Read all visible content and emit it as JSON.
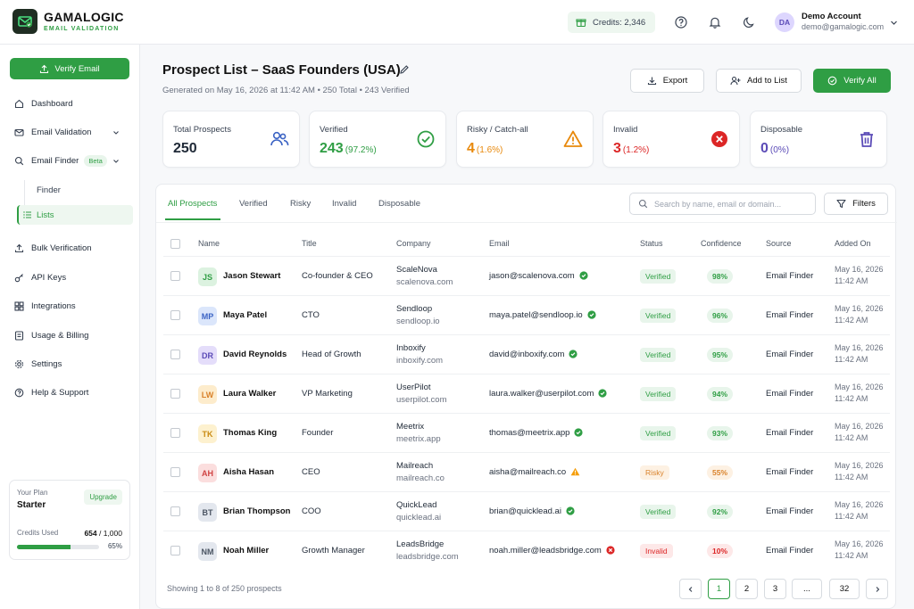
{
  "app": {
    "name": "GAMALOGIC",
    "tagline": "EMAIL VALIDATION"
  },
  "topbar": {
    "credits_label": "Credits: 2,346",
    "account_initials": "DA",
    "account_name": "Demo Account",
    "account_email": "demo@gamalogic.com",
    "icons": [
      "gift-icon",
      "help-icon",
      "bell-icon",
      "moon-icon",
      "chevron-down-icon"
    ]
  },
  "sidebar": {
    "verify_label": "Verify Email",
    "items": [
      {
        "label": "Dashboard",
        "icon": "home-icon"
      },
      {
        "label": "Email Validation",
        "icon": "mail-icon"
      },
      {
        "label": "Email Finder",
        "icon": "search-icon",
        "badge": "Beta"
      },
      {
        "label": "Bulk Verification",
        "icon": "upload-icon"
      },
      {
        "label": "API Keys",
        "icon": "key-icon"
      },
      {
        "label": "Integrations",
        "icon": "puzzle-icon"
      },
      {
        "label": "Usage & Billing",
        "icon": "billing-icon"
      },
      {
        "label": "Settings",
        "icon": "gear-icon"
      },
      {
        "label": "Help & Support",
        "icon": "help-icon"
      }
    ],
    "sub_items": [
      {
        "label": "Finder"
      },
      {
        "label": "Lists"
      }
    ],
    "plan": {
      "label": "Your Plan",
      "name": "Starter",
      "upgrade_label": "Upgrade",
      "credits_label": "Credits Used",
      "credits_used": "654",
      "credits_total": "/ 1,000",
      "percent_label": "65%",
      "percent": 65
    }
  },
  "page": {
    "title": "Prospect List – SaaS Founders (USA)",
    "subtitle": "Generated on May 16, 2026 at 11:42 AM  •  250 Total  •  243 Verified",
    "export_label": "Export",
    "add_label": "Add to List",
    "verify_all_label": "Verify All"
  },
  "stats": [
    {
      "label": "Total Prospects",
      "value": "250",
      "pct": "",
      "color": "#111111",
      "icon": "users-icon"
    },
    {
      "label": "Verified",
      "value": "243",
      "pct": "(97.2%)",
      "color": "#2f9e44",
      "icon": "check-circle-icon"
    },
    {
      "label": "Risky / Catch-all",
      "value": "4",
      "pct": "(1.6%)",
      "color": "#e8890c",
      "icon": "warning-icon"
    },
    {
      "label": "Invalid",
      "value": "3",
      "pct": "(1.2%)",
      "color": "#dc2626",
      "icon": "x-circle-icon"
    },
    {
      "label": "Disposable",
      "value": "0",
      "pct": "(0%)",
      "color": "#5b4bb7",
      "icon": "trash-icon"
    }
  ],
  "tabs": [
    {
      "label": "All Prospects",
      "active": true
    },
    {
      "label": "Verified"
    },
    {
      "label": "Risky"
    },
    {
      "label": "Invalid"
    },
    {
      "label": "Disposable"
    }
  ],
  "search": {
    "placeholder": "Search by name, email or domain..."
  },
  "filters_label": "Filters",
  "table": {
    "columns": [
      "Name",
      "Title",
      "Company",
      "Email",
      "Status",
      "Confidence",
      "Source",
      "Added On"
    ],
    "rows": [
      {
        "initials": "JS",
        "name": "Jason Stewart",
        "title": "Co-founder & CEO",
        "company": "ScaleNova",
        "domain": "scalenova.com",
        "email": "jason@scalenova.com",
        "status": "Verified",
        "confidence": "98%",
        "source": "Email Finder",
        "date": "May 16, 2026",
        "time": "11:42 AM",
        "avatar_bg": "#dcf2e0",
        "avatar_fg": "#2f9e44"
      },
      {
        "initials": "MP",
        "name": "Maya Patel",
        "title": "CTO",
        "company": "Sendloop",
        "domain": "sendloop.io",
        "email": "maya.patel@sendloop.io",
        "status": "Verified",
        "confidence": "96%",
        "source": "Email Finder",
        "date": "May 16, 2026",
        "time": "11:42 AM",
        "avatar_bg": "#dbe6fb",
        "avatar_fg": "#3b63c4"
      },
      {
        "initials": "DR",
        "name": "David Reynolds",
        "title": "Head of Growth",
        "company": "Inboxify",
        "domain": "inboxify.com",
        "email": "david@inboxify.com",
        "status": "Verified",
        "confidence": "95%",
        "source": "Email Finder",
        "date": "May 16, 2026",
        "time": "11:42 AM",
        "avatar_bg": "#e4ddfa",
        "avatar_fg": "#5b4bb7"
      },
      {
        "initials": "LW",
        "name": "Laura Walker",
        "title": "VP Marketing",
        "company": "UserPilot",
        "domain": "userpilot.com",
        "email": "laura.walker@userpilot.com",
        "status": "Verified",
        "confidence": "94%",
        "source": "Email Finder",
        "date": "May 16, 2026",
        "time": "11:42 AM",
        "avatar_bg": "#fdeccc",
        "avatar_fg": "#d9822b"
      },
      {
        "initials": "TK",
        "name": "Thomas King",
        "title": "Founder",
        "company": "Meetrix",
        "domain": "meetrix.app",
        "email": "thomas@meetrix.app",
        "status": "Verified",
        "confidence": "93%",
        "source": "Email Finder",
        "date": "May 16, 2026",
        "time": "11:42 AM",
        "avatar_bg": "#fdf1cf",
        "avatar_fg": "#c98a12"
      },
      {
        "initials": "AH",
        "name": "Aisha Hasan",
        "title": "CEO",
        "company": "Mailreach",
        "domain": "mailreach.co",
        "email": "aisha@mailreach.co",
        "status": "Risky",
        "confidence": "55%",
        "source": "Email Finder",
        "date": "May 16, 2026",
        "time": "11:42 AM",
        "avatar_bg": "#fbdede",
        "avatar_fg": "#d04444"
      },
      {
        "initials": "BT",
        "name": "Brian Thompson",
        "title": "COO",
        "company": "QuickLead",
        "domain": "quicklead.ai",
        "email": "brian@quicklead.ai",
        "status": "Verified",
        "confidence": "92%",
        "source": "Email Finder",
        "date": "May 16, 2026",
        "time": "11:42 AM",
        "avatar_bg": "#e3e7ee",
        "avatar_fg": "#4b5563"
      },
      {
        "initials": "NM",
        "name": "Noah Miller",
        "title": "Growth Manager",
        "company": "LeadsBridge",
        "domain": "leadsbridge.com",
        "email": "noah.miller@leadsbridge.com",
        "status": "Invalid",
        "confidence": "10%",
        "source": "Email Finder",
        "date": "May 16, 2026",
        "time": "11:42 AM",
        "avatar_bg": "#e3e7ee",
        "avatar_fg": "#4b5563"
      }
    ]
  },
  "pagination": {
    "showing": "Showing 1 to 8 of 250 prospects",
    "pages": [
      "1",
      "2",
      "3",
      "...",
      "32"
    ],
    "active": "1"
  },
  "colors": {
    "accent": "#2f9e44",
    "risky": "#e8890c",
    "invalid": "#dc2626",
    "disposable": "#5b4bb7"
  }
}
